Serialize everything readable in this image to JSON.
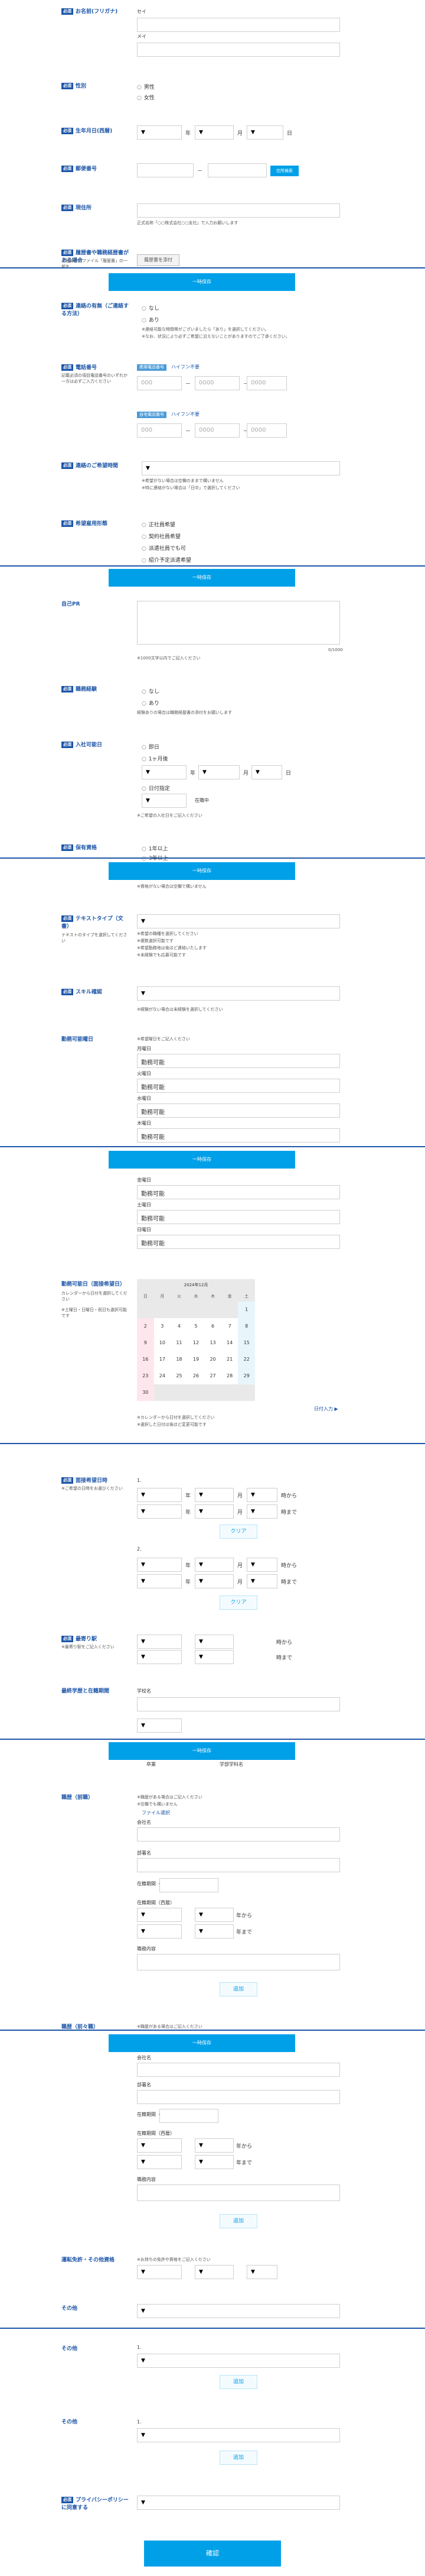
{
  "kana": {
    "label": "お名前(フリガナ)",
    "sei": "セイ",
    "mei": "メイ"
  },
  "gender": {
    "label": "性別",
    "options": [
      "男性",
      "女性"
    ]
  },
  "birth": {
    "label": "生年月日(西暦)",
    "year": "年",
    "month": "月",
    "day": "日"
  },
  "postal": {
    "label": "郵便番号",
    "dash": "－",
    "button": "住所検索"
  },
  "address": {
    "label": "現住所",
    "hint": "正式名称「○○株式会社○○支社」で入力お願いします"
  },
  "resume": {
    "label": "履歴書や職務経歴書がある場合",
    "note": "ご登録中のファイル「履歴書」の一部を…",
    "button": "履歴書を添付"
  },
  "banner_label": "一時保存",
  "mobile": {
    "label": "電話番号",
    "tag1": "携帯電話番号",
    "tag1_note": "ハイフン不要",
    "tag2": "自宅電話番号",
    "tag2_note": "ハイフン不要",
    "note": "記載必須の項目電話番号のいずれか一方は必ずご入力ください",
    "ph1": "000",
    "ph2": "0000",
    "ph3": "0000"
  },
  "contact": {
    "label": "連絡の有無（ご連絡する方法）",
    "options": [
      "なし",
      "あり"
    ],
    "note1": "※連絡可能な時間帯がございましたら「あり」を選択してください。",
    "note2": "※なお、状況により必ずご希望に沿えないことがありますのでご了承ください。"
  },
  "contact_time": {
    "label": "連絡のご希望時間",
    "note1": "※希望がない場合は空欄のままで構いません",
    "note2": "※特に連絡がない場合は「日中」で選択してください"
  },
  "employment": {
    "label": "希望雇用形態",
    "options": [
      "正社員希望",
      "契約社員希望",
      "派遣社員でも可",
      "紹介予定派遣希望"
    ]
  },
  "self_pr": {
    "label": "自己PR",
    "counter": "0/1000",
    "note": "※1000文字以内でご記入ください"
  },
  "experience": {
    "label": "職務経験",
    "options": [
      "なし",
      "あり"
    ],
    "note": "経験ありの場合は職務経歴書の添付をお願いします"
  },
  "start": {
    "label": "入社可能日",
    "options": [
      "即日",
      "1ヶ月後",
      "日付指定"
    ],
    "note": "※ご希望の入社日をご記入ください",
    "year": "年",
    "month": "月",
    "day": "日",
    "status": "在職中"
  },
  "qualification": {
    "label": "保有資格",
    "options": [
      "1年以上",
      "3年以上"
    ],
    "note": "※資格がない場合は空欄で構いません"
  },
  "text_type": {
    "label": "テキストタイプ（文書）",
    "note": "テキストのタイプを選択してください",
    "hint1": "※希望の職種を選択してください",
    "hint2": "※複数選択可能です",
    "hint3": "※希望勤務地は後ほど連絡いたします",
    "hint4": "※未経験でも応募可能です"
  },
  "skill": {
    "label": "スキル確認",
    "note": "※経験がない場合は未経験を選択してください"
  },
  "weekday": {
    "label": "勤務可能曜日",
    "note": "※希望曜日をご記入ください",
    "days": [
      "月曜日",
      "火曜日",
      "水曜日",
      "木曜日",
      "金曜日",
      "土曜日",
      "日曜日"
    ],
    "value": "勤務可能"
  },
  "calendar": {
    "label": "勤務可能日（面接希望日）",
    "note1": "カレンダーから日付を選択してください",
    "note2": "※土曜日・日曜日・祝日も選択可能です",
    "title": "2024年12月",
    "weekdays": [
      "日",
      "月",
      "火",
      "水",
      "木",
      "金",
      "土"
    ],
    "rows": [
      [
        "",
        "",
        "",
        "",
        "",
        "",
        "1"
      ],
      [
        "2",
        "3",
        "4",
        "5",
        "6",
        "7",
        "8"
      ],
      [
        "9",
        "10",
        "11",
        "12",
        "13",
        "14",
        "15"
      ],
      [
        "16",
        "17",
        "18",
        "19",
        "20",
        "21",
        "22"
      ],
      [
        "23",
        "24",
        "25",
        "26",
        "27",
        "28",
        "29"
      ],
      [
        "30",
        "",
        "",
        "",
        "",
        "",
        ""
      ]
    ],
    "link": "日付入力 ▶",
    "foot1": "※カレンダーから日付を選択してください",
    "foot2": "※選択した日付は後ほど変更可能です"
  },
  "interview": {
    "label": "面接希望日時",
    "note": "※ご希望の日時をお選びください",
    "row_label_1": "1.",
    "row_label_2": "2.",
    "from": "時から",
    "to": "時まで",
    "clear": "クリア"
  },
  "commute": {
    "label": "最寄り駅",
    "note": "※最寄り駅をご記入ください",
    "from": "時から",
    "to": "時まで"
  },
  "school": {
    "label": "最終学歴と在籍期間",
    "sub1": "学校名",
    "sub2": "卒業",
    "sub3": "学部学科名"
  },
  "career1": {
    "label": "職歴（前職）",
    "note1": "※職歴がある場合はご記入ください",
    "note2": "※空欄でも構いません",
    "link": "ファイル選択",
    "company": "会社名",
    "dept": "部署名",
    "period": "在籍期間（西暦）",
    "from": "年から",
    "to": "年まで",
    "duties": "職務内容",
    "add": "追加"
  },
  "career2": {
    "label": "職歴（前々職）",
    "note1": "※職歴がある場合はご記入ください",
    "company": "会社名",
    "dept": "部署名",
    "period": "在籍期間（西暦）",
    "from": "年から",
    "to": "年まで",
    "duties": "職務内容",
    "add": "追加"
  },
  "license": {
    "label": "運転免許・その他資格",
    "note": "※お持ちの免許や資格をご記入ください"
  },
  "misc1": {
    "label": "その他",
    "sub": "1."
  },
  "misc2": {
    "label": "その他",
    "sub": "1.",
    "add": "追加"
  },
  "misc3": {
    "label": "その他",
    "sub": "1.",
    "add": "追加"
  },
  "agree": {
    "label": "プライバシーポリシーに同意する"
  },
  "submit": "確認",
  "colors": {
    "accent": "#00a0e9",
    "label": "#1d56a8"
  }
}
